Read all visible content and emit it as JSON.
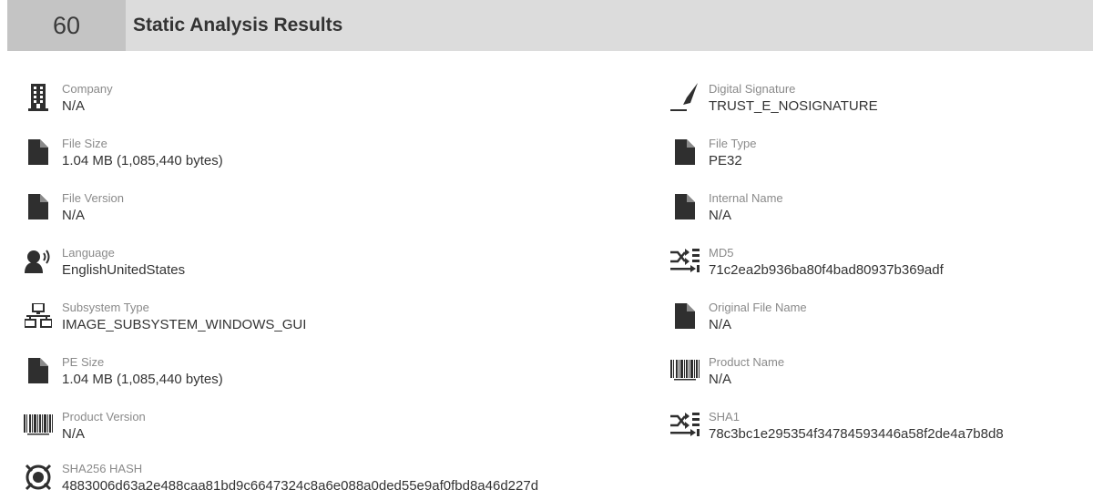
{
  "header": {
    "number": "60",
    "title": "Static Analysis Results"
  },
  "left": {
    "company": {
      "label": "Company",
      "value": "N/A",
      "icon": "building-icon"
    },
    "file_size": {
      "label": "File Size",
      "value": "1.04 MB (1,085,440 bytes)",
      "icon": "file-icon"
    },
    "file_version": {
      "label": "File Version",
      "value": "N/A",
      "icon": "file-icon"
    },
    "language": {
      "label": "Language",
      "value": "EnglishUnitedStates",
      "icon": "speaker-icon"
    },
    "subsystem_type": {
      "label": "Subsystem Type",
      "value": "IMAGE_SUBSYSTEM_WINDOWS_GUI",
      "icon": "network-icon"
    },
    "pe_size": {
      "label": "PE Size",
      "value": "1.04 MB (1,085,440 bytes)",
      "icon": "file-icon"
    },
    "product_version": {
      "label": "Product Version",
      "value": "N/A",
      "icon": "barcode-icon"
    },
    "sha256": {
      "label": "SHA256 HASH",
      "value": "4883006d63a2e488caa81bd9c6647324c8a6e088a0ded55e9af0fbd8a46d227d",
      "icon": "target-icon"
    }
  },
  "right": {
    "digital_signature": {
      "label": "Digital Signature",
      "value": "TRUST_E_NOSIGNATURE",
      "icon": "signature-pen-icon"
    },
    "file_type": {
      "label": "File Type",
      "value": "PE32",
      "icon": "file-icon"
    },
    "internal_name": {
      "label": "Internal Name",
      "value": "N/A",
      "icon": "file-icon"
    },
    "md5": {
      "label": "MD5",
      "value": "71c2ea2b936ba80f4bad80937b369adf",
      "icon": "hash-shuffle-icon"
    },
    "original_file_name": {
      "label": "Original File Name",
      "value": "N/A",
      "icon": "file-icon"
    },
    "product_name": {
      "label": "Product Name",
      "value": "N/A",
      "icon": "barcode-icon"
    },
    "sha1": {
      "label": "SHA1",
      "value": "78c3bc1e295354f34784593446a58f2de4a7b8d8",
      "icon": "hash-shuffle-icon"
    }
  },
  "colors": {
    "header_bg": "#dcdcdc",
    "number_bg": "#c4c4c4",
    "icon": "#2f2f2f",
    "label": "#8a8a8a",
    "value": "#333333"
  }
}
